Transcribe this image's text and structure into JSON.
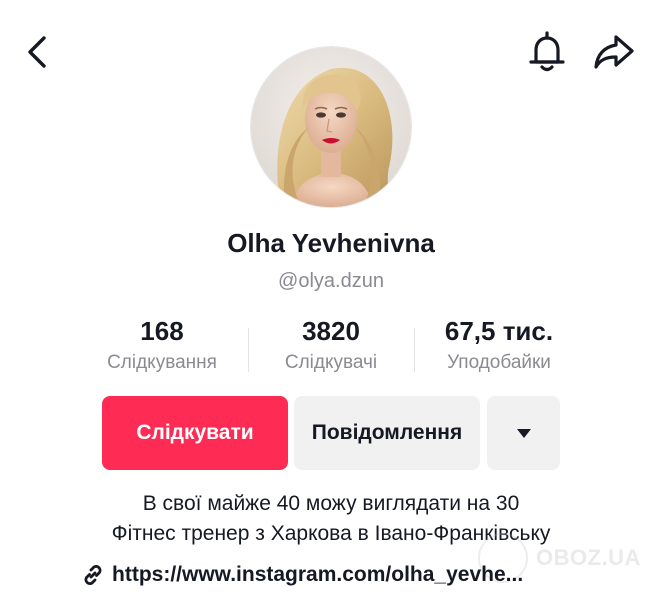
{
  "header": {
    "back_icon": "chevron-left-icon",
    "bell_icon": "bell-icon",
    "share_icon": "share-arrow-icon"
  },
  "profile": {
    "display_name": "Olha Yevhenivna",
    "handle": "@olya.dzun",
    "avatar": "profile-photo"
  },
  "stats": [
    {
      "value": "168",
      "label": "Слідкування"
    },
    {
      "value": "3820",
      "label": "Слідкувачі"
    },
    {
      "value": "67,5 тис.",
      "label": "Уподобайки"
    }
  ],
  "actions": {
    "follow_label": "Слідкувати",
    "message_label": "Повідомлення",
    "more_icon": "caret-down-icon"
  },
  "bio": {
    "line1": "В свої майже 40 можу виглядати на 30",
    "line2": "Фітнес тренер з Харкова в Івано-Франківську",
    "link": "https://www.instagram.com/olha_yevhe..."
  },
  "watermark": {
    "text": "OBOZ.UA"
  },
  "colors": {
    "accent": "#fe2c55",
    "secondary_bg": "#f1f1f2",
    "text_primary": "#161823",
    "text_secondary": "#8a8b91"
  }
}
